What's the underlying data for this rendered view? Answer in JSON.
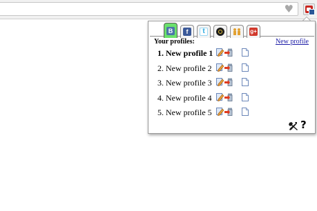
{
  "browser": {
    "star_icon": "star-icon",
    "extension_icon": "extension-icon"
  },
  "popup": {
    "tabs": [
      {
        "icon": "vk-icon",
        "glyph": "В",
        "active": true
      },
      {
        "icon": "facebook-icon",
        "glyph": "f",
        "active": false
      },
      {
        "icon": "twitter-icon",
        "glyph": "t",
        "active": false
      },
      {
        "icon": "odnoklassniki-icon",
        "glyph": "",
        "active": false
      },
      {
        "icon": "people-icon",
        "glyph": "",
        "active": false
      },
      {
        "icon": "google-plus-icon",
        "glyph": "g+",
        "active": false
      }
    ],
    "profiles_label": "Your profiles:",
    "new_profile_link": "New profile",
    "profiles": [
      {
        "number": "1.",
        "name": "New profile 1",
        "active": true
      },
      {
        "number": "2.",
        "name": "New profile 2",
        "active": false
      },
      {
        "number": "3.",
        "name": "New profile 3",
        "active": false
      },
      {
        "number": "4.",
        "name": "New profile 4",
        "active": false
      },
      {
        "number": "5.",
        "name": "New profile 5",
        "active": false
      }
    ],
    "row_icons": [
      "edit-icon",
      "delete-icon",
      "document-icon"
    ],
    "footer_icons": [
      "tools-icon",
      "help-icon"
    ],
    "help_glyph": "?"
  },
  "colors": {
    "active_tab": "#6be06b",
    "link": "#1a1aa6",
    "extension_red": "#c8261f"
  }
}
